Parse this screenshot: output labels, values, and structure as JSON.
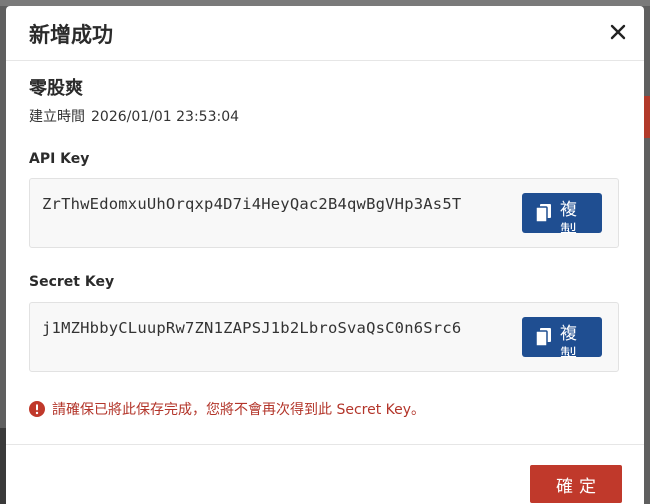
{
  "dialog": {
    "title": "新增成功",
    "name": "零股爽",
    "created_label": "建立時間",
    "created_value": "2026/01/01 23:53:04"
  },
  "api_key": {
    "label": "API Key",
    "value": "ZrThwEdomxuUhOrqxp4D7i4HeyQac2B4qwBgVHp3As5T",
    "copy_label": "複製"
  },
  "secret_key": {
    "label": "Secret Key",
    "value": "j1MZHbbyCLuupRw7ZN1ZAPSJ1b2LbroSvaQsC0n6Src6",
    "copy_label": "複製"
  },
  "warning": {
    "text": "請確保已將此保存完成，您將不會再次得到此 Secret Key。"
  },
  "footer": {
    "confirm_label": "確定"
  },
  "colors": {
    "primary_button": "#1f4e91",
    "confirm_button": "#c0392b",
    "warning_text": "#b3352a"
  },
  "icons": {
    "close": "close-icon",
    "copy": "copy-icon",
    "warning": "warning-circle-icon"
  }
}
